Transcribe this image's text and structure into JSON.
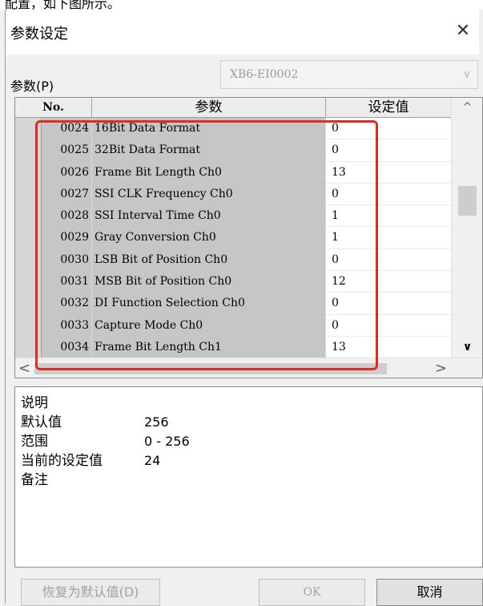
{
  "top_fragment": "配置，如下图所示。",
  "dialog": {
    "title": "参数设定",
    "close_glyph": "✕",
    "param_label": "参数(P)",
    "param_value": "XB6-EI0002",
    "combo_arrow": "∨"
  },
  "grid": {
    "headers": {
      "no": "No.",
      "param": "参数",
      "value": "设定值"
    },
    "rows": [
      {
        "no": "0024",
        "param": "16Bit Data Format",
        "value": "0"
      },
      {
        "no": "0025",
        "param": "32Bit Data Format",
        "value": "0"
      },
      {
        "no": "0026",
        "param": "Frame Bit Length Ch0",
        "value": "13"
      },
      {
        "no": "0027",
        "param": "SSI CLK Frequency Ch0",
        "value": "0"
      },
      {
        "no": "0028",
        "param": "SSI Interval Time Ch0",
        "value": "1"
      },
      {
        "no": "0029",
        "param": "Gray Conversion Ch0",
        "value": "1"
      },
      {
        "no": "0030",
        "param": "LSB Bit of Position Ch0",
        "value": "0"
      },
      {
        "no": "0031",
        "param": "MSB Bit of Position Ch0",
        "value": "12"
      },
      {
        "no": "0032",
        "param": "DI Function Selection Ch0",
        "value": "0"
      },
      {
        "no": "0033",
        "param": "Capture Mode Ch0",
        "value": "0"
      },
      {
        "no": "0034",
        "param": "Frame Bit Length Ch1",
        "value": "13"
      }
    ],
    "scroll_up": "^",
    "scroll_down": "∨",
    "scroll_left": "<",
    "scroll_right": ">",
    "highlight_color": "#e02b22"
  },
  "description": {
    "heading": "说明",
    "default_label": "默认值",
    "default_value": "256",
    "range_label": "范围",
    "range_value": "0 - 256",
    "current_label": "当前的设定值",
    "current_value": "24",
    "note_label": "备注"
  },
  "buttons": {
    "restore_default": "恢复为默认值(D)",
    "ok": "OK",
    "cancel": "取消"
  }
}
